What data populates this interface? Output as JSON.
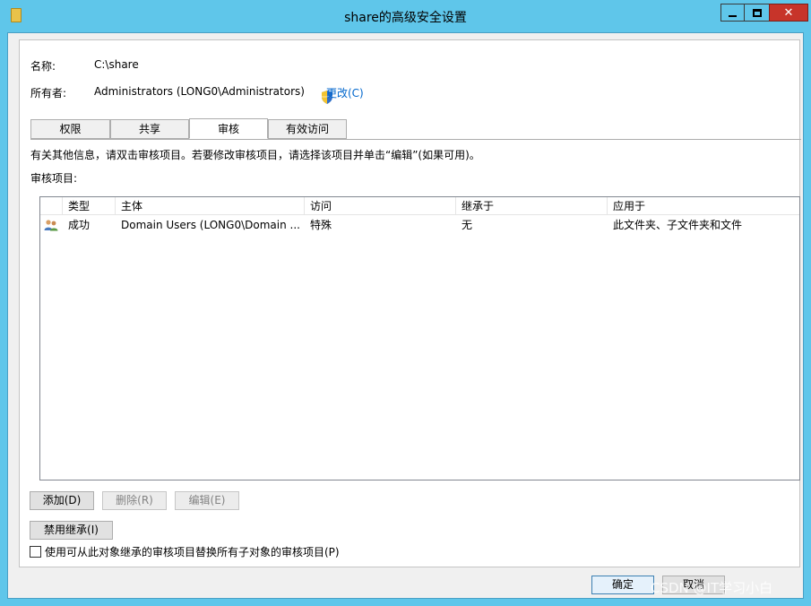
{
  "window": {
    "title": "share的高级安全设置"
  },
  "info": {
    "name_label": "名称:",
    "name_value": "C:\\share",
    "owner_label": "所有者:",
    "owner_value": "Administrators (LONG0\\Administrators)",
    "change_link": "更改(C)"
  },
  "tabs": [
    {
      "label": "权限"
    },
    {
      "label": "共享"
    },
    {
      "label": "审核"
    },
    {
      "label": "有效访问"
    }
  ],
  "description": "有关其他信息，请双击审核项目。若要修改审核项目，请选择该项目并单击“编辑”(如果可用)。",
  "audit_label": "审核项目:",
  "table": {
    "headers": [
      "类型",
      "主体",
      "访问",
      "继承于",
      "应用于"
    ],
    "rows": [
      {
        "type": "成功",
        "principal": "Domain Users (LONG0\\Domain ...",
        "access": "特殊",
        "inherited_from": "无",
        "applies_to": "此文件夹、子文件夹和文件"
      }
    ]
  },
  "buttons": {
    "add": "添加(D)",
    "remove": "删除(R)",
    "edit": "编辑(E)",
    "disable_inheritance": "禁用继承(I)",
    "ok": "确定",
    "cancel": "取消"
  },
  "replace_checkbox_label": "使用可从此对象继承的审核项目替换所有子对象的审核项目(P)",
  "watermark": "CSDN @IT学习小白"
}
